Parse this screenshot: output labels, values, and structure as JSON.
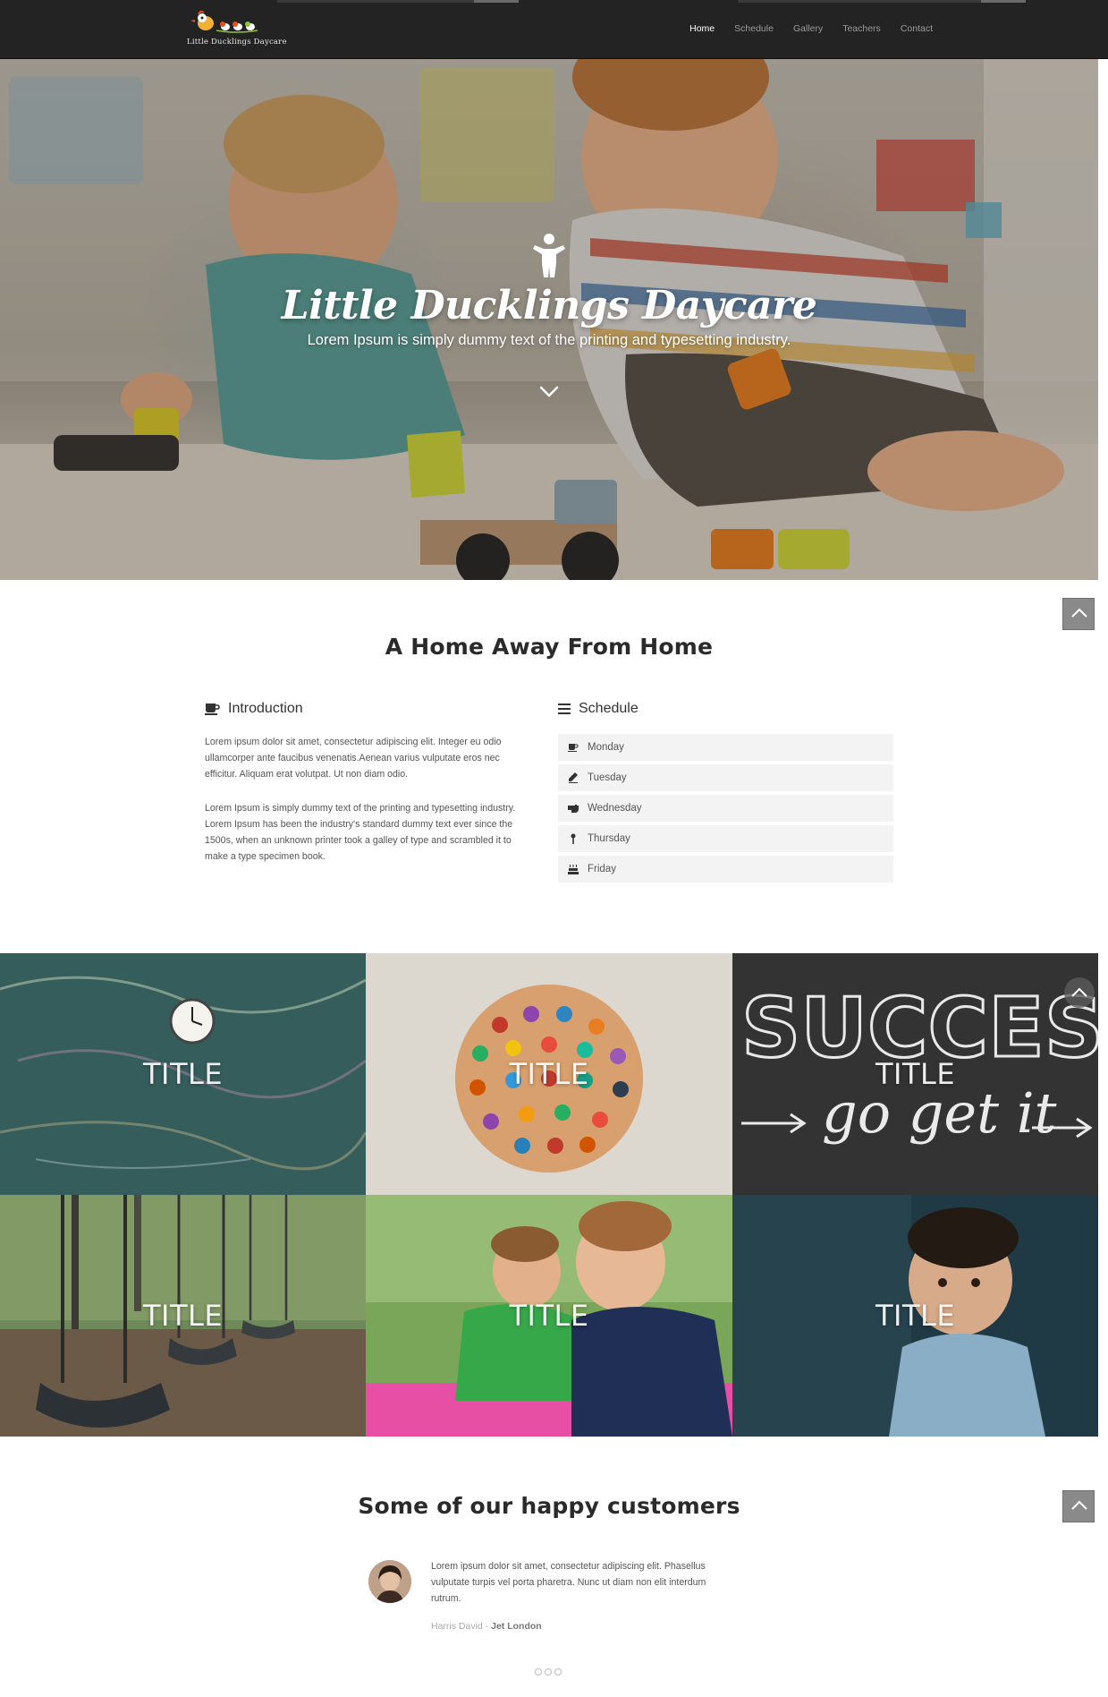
{
  "brand": {
    "logo_text": "Little Ducklings Daycare"
  },
  "nav": {
    "items": [
      {
        "label": "Home",
        "active": true
      },
      {
        "label": "Schedule",
        "active": false
      },
      {
        "label": "Gallery",
        "active": false
      },
      {
        "label": "Teachers",
        "active": false
      },
      {
        "label": "Contact",
        "active": false
      }
    ]
  },
  "hero": {
    "title": "Little Ducklings Daycare",
    "subtitle": "Lorem Ipsum is simply dummy text of the printing and typesetting industry.",
    "icon": "child-figure-icon",
    "scroll_icon": "chevron-down-icon"
  },
  "about": {
    "title": "A Home Away From Home",
    "introduction": {
      "heading": "Introduction",
      "icon": "coffee-cup-icon",
      "paragraphs": [
        "Lorem ipsum dolor sit amet, consectetur adipiscing elit. Integer eu odio ullamcorper ante faucibus venenatis.Aenean varius vulputate eros nec efficitur. Aliquam erat volutpat. Ut non diam odio.",
        "Lorem Ipsum is simply dummy text of the printing and typesetting industry. Lorem Ipsum has been the industry's standard dummy text ever since the 1500s, when an unknown printer took a galley of type and scrambled it to make a type specimen book."
      ]
    },
    "schedule": {
      "heading": "Schedule",
      "icon": "list-icon",
      "days": [
        {
          "label": "Monday",
          "icon": "coffee-cup-icon"
        },
        {
          "label": "Tuesday",
          "icon": "pencil-icon"
        },
        {
          "label": "Wednesday",
          "icon": "hand-icon"
        },
        {
          "label": "Thursday",
          "icon": "pin-icon"
        },
        {
          "label": "Friday",
          "icon": "cake-icon"
        }
      ]
    }
  },
  "gallery": {
    "tiles": [
      {
        "title": "TITLE"
      },
      {
        "title": "TITLE"
      },
      {
        "title": "TITLE"
      },
      {
        "title": "TITLE"
      },
      {
        "title": "TITLE"
      },
      {
        "title": "TITLE"
      }
    ]
  },
  "testimonials": {
    "title": "Some of our happy customers",
    "items": [
      {
        "quote": "Lorem ipsum dolor sit amet, consectetur adipiscing elit. Phasellus vulputate turpis vel porta pharetra. Nunc ut diam non elit interdum rutrum.",
        "author": "Harris David",
        "separator": " - ",
        "location": "Jet London"
      }
    ],
    "page_count": 3
  },
  "colors": {
    "nav_bg": "#232323",
    "schedule_row_bg": "#f3f3f3",
    "scroll_top_btn": "#8a8a8a"
  }
}
